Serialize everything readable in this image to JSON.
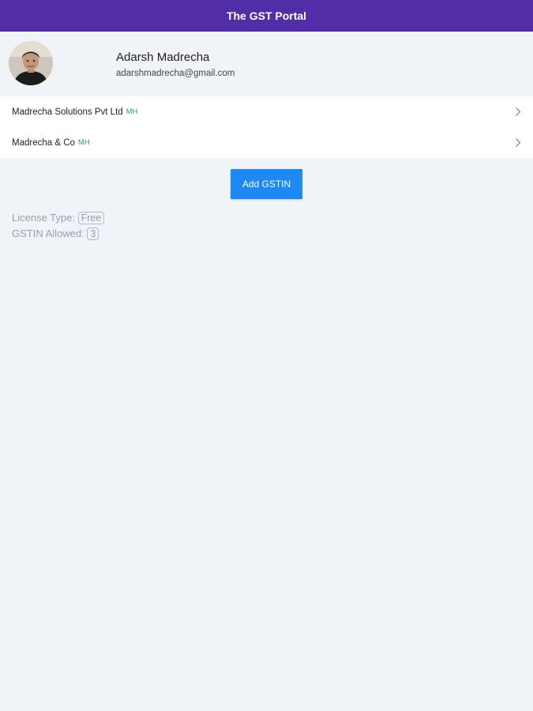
{
  "header": {
    "title": "The GST Portal"
  },
  "profile": {
    "name": "Adarsh Madrecha",
    "email": "adarshmadrecha@gmail.com"
  },
  "gstins": [
    {
      "name": "Madrecha Solutions Pvt Ltd",
      "state": "MH"
    },
    {
      "name": "Madrecha & Co",
      "state": "MH"
    }
  ],
  "actions": {
    "add_gstin_label": "Add GSTIN"
  },
  "license": {
    "type_label": "License Type:",
    "type_value": "Free",
    "allowed_label": "GSTIN Allowed:",
    "allowed_value": "3"
  },
  "colors": {
    "header_bg": "#512da8",
    "button_bg": "#1e88f5",
    "state_tag": "#2e9c8a",
    "page_bg": "#f0f3f8"
  }
}
